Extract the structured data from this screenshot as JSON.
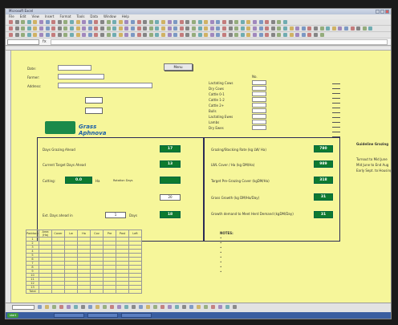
{
  "window": {
    "title": "Microsoft Excel"
  },
  "menu": [
    "File",
    "Edit",
    "View",
    "Insert",
    "Format",
    "Tools",
    "Data",
    "Window",
    "Help"
  ],
  "formula_bar": {
    "name_box": "",
    "fx": "fx",
    "content": ""
  },
  "form": {
    "date_label": "Date:",
    "date_value": "",
    "farmer_label": "Farmer:",
    "farmer_value": "",
    "address_label": "Address:",
    "address_value": "",
    "button_label": "Menu",
    "version": ""
  },
  "brand": {
    "logo": "Grass Aphnova"
  },
  "left_panel": {
    "days_grazing_ahead_label": "Days Grazing Ahead",
    "days_grazing_ahead_value": "17",
    "current_target_label": "Current Target Days Ahead",
    "current_target_value": "13",
    "cutting_label": "Cutting:",
    "cutting_value": "0.0",
    "cutting_unit": "Ha",
    "rotation_days_label": "Rotation Days",
    "rotation_days_value": "20",
    "ext_days_label": "Ext. Days ahead in",
    "ext_days_value": "1",
    "ext_days_unit": "Days",
    "ext_days_result": "18"
  },
  "right_panel": {
    "grazing_stocking_label": "Grazing/Stocking Rate (kg LW/ Ha)",
    "grazing_stocking_value": "780",
    "lwl_cover_label": "LWL Cover / Ha (kg DM/Ha)",
    "lwl_cover_value": "989",
    "target_pre_grazing_label": "Target Pre-Grazing Cover (kgDM/Ha)",
    "target_pre_grazing_value": "318",
    "grass_growth_label": "Grass Growth (kg DM/Ha/Day)",
    "grass_growth_value": "31",
    "growth_demand_label": "Growth demand to Meet Herd Demand (kgDM/Day)",
    "growth_demand_value": "31"
  },
  "side_note": {
    "title": "Guideline Grazing",
    "lines": [
      "Turnout to Mid June",
      "Mid June to End Aug",
      "Early Sept. to Housing"
    ]
  },
  "stock_table": {
    "rows": [
      "Lactating Cows",
      "Dry Cows",
      "Cattle 0-1",
      "Cattle 1-2",
      "Cattle 2+",
      "Bulls",
      "Lactating Ewes",
      "Lambs",
      "Dry Ewes"
    ],
    "values": [
      "",
      "",
      "",
      "",
      "",
      "",
      "",
      "",
      ""
    ]
  },
  "daily_table": {
    "headers": [
      "Paddock",
      "Area (Ha)",
      "Cover",
      "Lw",
      "Ha",
      "Cov",
      "Pre",
      "Post",
      "Left"
    ],
    "rows": [
      [
        "1",
        "",
        "",
        "",
        "",
        "",
        "",
        "",
        ""
      ],
      [
        "2",
        "",
        "",
        "",
        "",
        "",
        "",
        "",
        ""
      ],
      [
        "3",
        "",
        "",
        "",
        "",
        "",
        "",
        "",
        ""
      ],
      [
        "4",
        "",
        "",
        "",
        "",
        "",
        "",
        "",
        ""
      ],
      [
        "5",
        "",
        "",
        "",
        "",
        "",
        "",
        "",
        ""
      ],
      [
        "6",
        "",
        "",
        "",
        "",
        "",
        "",
        "",
        ""
      ],
      [
        "7",
        "",
        "",
        "",
        "",
        "",
        "",
        "",
        ""
      ],
      [
        "8",
        "",
        "",
        "",
        "",
        "",
        "",
        "",
        ""
      ],
      [
        "9",
        "",
        "",
        "",
        "",
        "",
        "",
        "",
        ""
      ],
      [
        "10",
        "",
        "",
        "",
        "",
        "",
        "",
        "",
        ""
      ],
      [
        "11",
        "",
        "",
        "",
        "",
        "",
        "",
        "",
        ""
      ],
      [
        "12",
        "",
        "",
        "",
        "",
        "",
        "",
        "",
        ""
      ],
      [
        "13",
        "",
        "",
        "",
        "",
        "",
        "",
        "",
        ""
      ],
      [
        "Total",
        "",
        "",
        "",
        "",
        "",
        "",
        "",
        ""
      ]
    ]
  },
  "notes": {
    "title": "NOTES:",
    "lines": [
      "",
      "",
      "",
      "",
      "",
      "",
      "",
      ""
    ]
  },
  "status": {
    "sheet_tab": "",
    "ready": ""
  },
  "taskbar": {
    "start": "start",
    "tasks": [
      "",
      "",
      ""
    ]
  },
  "colors": {
    "sheet_bg": "#f6f69a",
    "green": "#0d7a2f",
    "panel_border": "#2a2a55"
  }
}
